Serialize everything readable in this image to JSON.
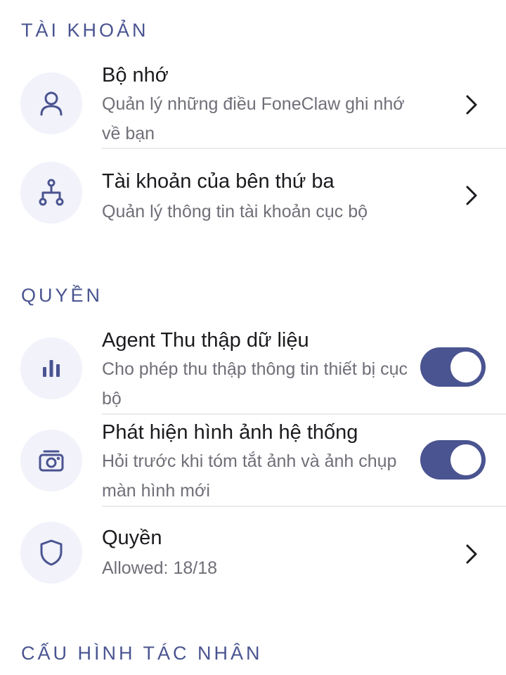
{
  "sections": {
    "account": {
      "header": "TÀI KHOẢN"
    },
    "permissions": {
      "header": "QUYỀN"
    },
    "agent_config": {
      "header": "CẤU HÌNH TÁC NHÂN"
    }
  },
  "items": {
    "memory": {
      "title": "Bộ nhớ",
      "subtitle": "Quản lý những điều FoneClaw ghi nhớ về bạn",
      "icon": "person-icon"
    },
    "third_party": {
      "title": "Tài khoản của bên thứ ba",
      "subtitle": "Quản lý thông tin tài khoản cục bộ",
      "icon": "account-tree-icon"
    },
    "data_collection": {
      "title": "Agent Thu thập dữ liệu",
      "subtitle": "Cho phép thu thập thông tin thiết bị cục bộ",
      "icon": "bar-chart-icon",
      "enabled": true
    },
    "image_detection": {
      "title": "Phát hiện hình ảnh hệ thống",
      "subtitle": "Hỏi trước khi tóm tắt ảnh và ảnh chụp màn hình mới",
      "icon": "camera-icon",
      "enabled": true
    },
    "permissions": {
      "title": "Quyền",
      "subtitle": "Allowed: 18/18",
      "icon": "shield-icon"
    }
  },
  "colors": {
    "accent": "#4a5490",
    "icon_bg": "#f1f2fa",
    "subtitle": "#6f6f78"
  }
}
